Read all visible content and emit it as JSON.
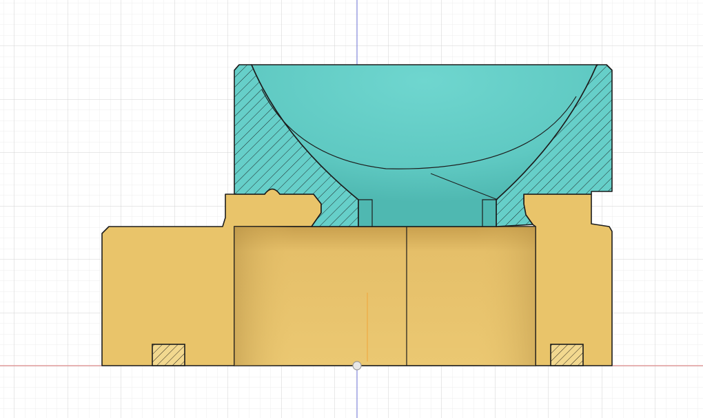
{
  "viewport": {
    "name": "cad-section-view",
    "grid": true,
    "axes": {
      "vertical_axis_color": "#6b72d6",
      "horizontal_axis_color": "#e27a7a",
      "origin_marker": true
    }
  },
  "parts": [
    {
      "name": "spherical-cup-body",
      "color": "#66cfc9",
      "section_hatch": true
    },
    {
      "name": "base-housing",
      "color": "#e9c46a",
      "section_hatch": false
    },
    {
      "name": "inserts",
      "color": "#f2d88f",
      "section_hatch": true
    }
  ],
  "colors": {
    "outline": "#1c1c1c",
    "grid_minor": "#e6e6e6",
    "grid_major": "#cfcfcf",
    "teal": "#66cfc9",
    "teal_dark": "#4fbdb6",
    "tan": "#e9c46a",
    "tan_shadow": "#c8a24e",
    "bore": "#e8c46d"
  }
}
